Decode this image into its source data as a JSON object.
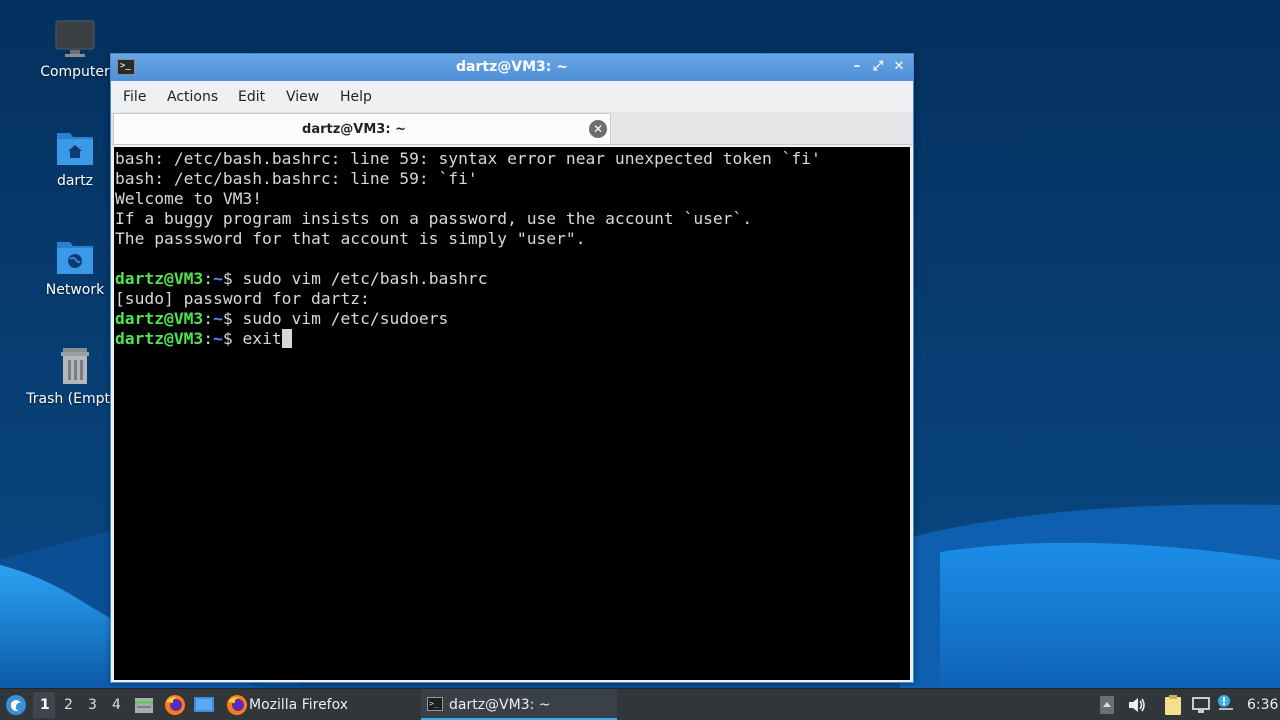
{
  "desktop": {
    "icons": [
      {
        "label": "Computer",
        "icon": "computer-icon"
      },
      {
        "label": "dartz",
        "icon": "home-folder-icon"
      },
      {
        "label": "Network",
        "icon": "network-folder-icon"
      },
      {
        "label": "Trash (Empty)",
        "icon": "trash-icon"
      }
    ]
  },
  "window": {
    "title": "dartz@VM3: ~",
    "controls": {
      "minimize": "–",
      "maximize": "⤢",
      "close": "✕"
    },
    "menu": [
      "File",
      "Actions",
      "Edit",
      "View",
      "Help"
    ],
    "tab": {
      "label": "dartz@VM3: ~",
      "close": "✕"
    }
  },
  "terminal": {
    "output": [
      "bash: /etc/bash.bashrc: line 59: syntax error near unexpected token `fi'",
      "bash: /etc/bash.bashrc: line 59: `fi'",
      "Welcome to VM3!",
      "If a buggy program insists on a password, use the account `user`.",
      "The passsword for that account is simply \"user\"."
    ],
    "prompt": {
      "user_host": "dartz@VM3",
      "sep": ":",
      "path": "~",
      "symbol": "$ "
    },
    "cmd1": "sudo vim /etc/bash.bashrc",
    "sudo_line": "[sudo] password for dartz:",
    "cmd2": "sudo vim /etc/sudoers",
    "cmd3": "exit"
  },
  "taskbar": {
    "workspaces": [
      "1",
      "2",
      "3",
      "4"
    ],
    "active_workspace": "1",
    "tasks": [
      {
        "label": "Mozilla Firefox",
        "icon": "firefox-icon"
      },
      {
        "label": "dartz@VM3: ~",
        "icon": "terminal-icon",
        "active": true
      }
    ],
    "clock": "6:36"
  },
  "colors": {
    "accent": "#3daee9",
    "prompt_user": "#4fe34f",
    "prompt_path": "#5a8cff",
    "titlebar": "#4d8fd8"
  }
}
